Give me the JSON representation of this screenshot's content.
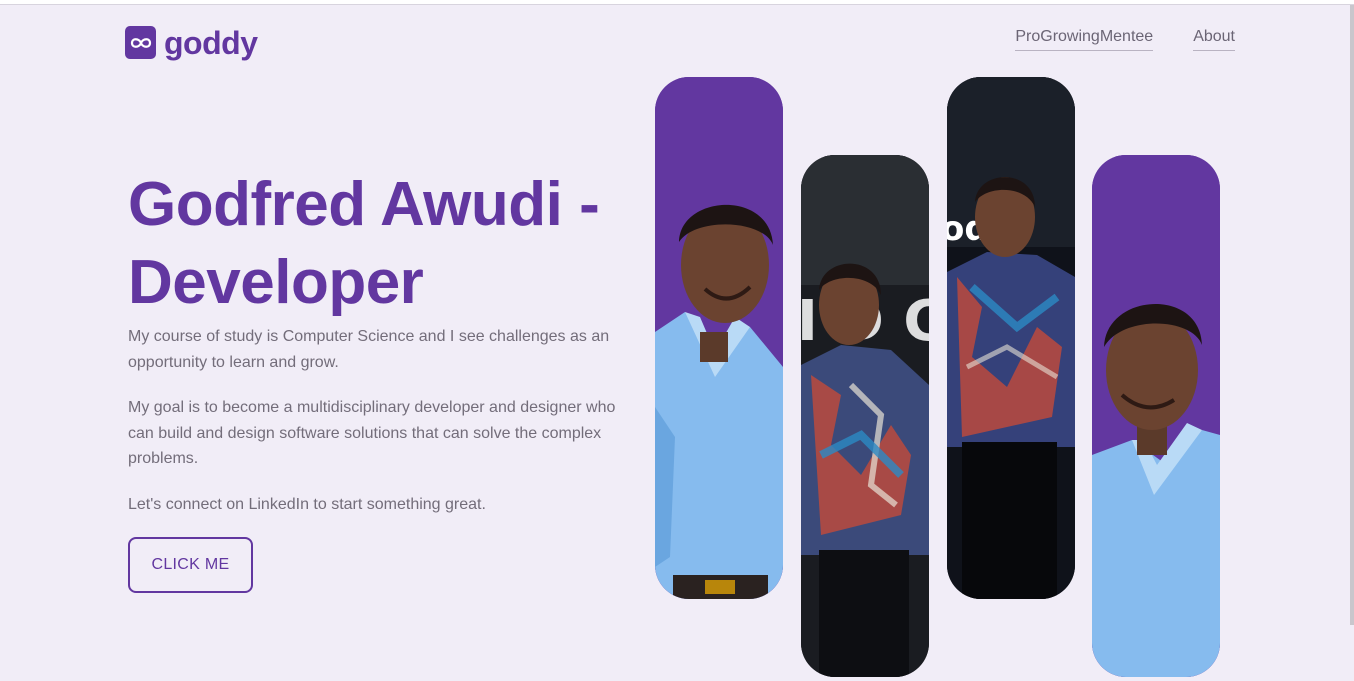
{
  "brand": {
    "name": "goddy",
    "logo_icon": "infinity-icon"
  },
  "nav": {
    "items": [
      "ProGrowingMentee",
      "About"
    ]
  },
  "hero": {
    "title_line1": "Godfred Awudi -",
    "title_line2": "Developer",
    "paragraph1": "My course of study is Computer Science and I see challenges as an opportunity to learn and grow.",
    "paragraph2": "My goal is to become a multidisciplinary developer and designer who can build and design software solutions that can solve the complex problems.",
    "paragraph3": "Let's connect on LinkedIn to start something great.",
    "cta_label": "CLICK ME"
  },
  "colors": {
    "accent": "#6237a0",
    "background": "#f1edf7",
    "body_text": "#736d7a",
    "shirt_blue": "#7fb6ea"
  }
}
